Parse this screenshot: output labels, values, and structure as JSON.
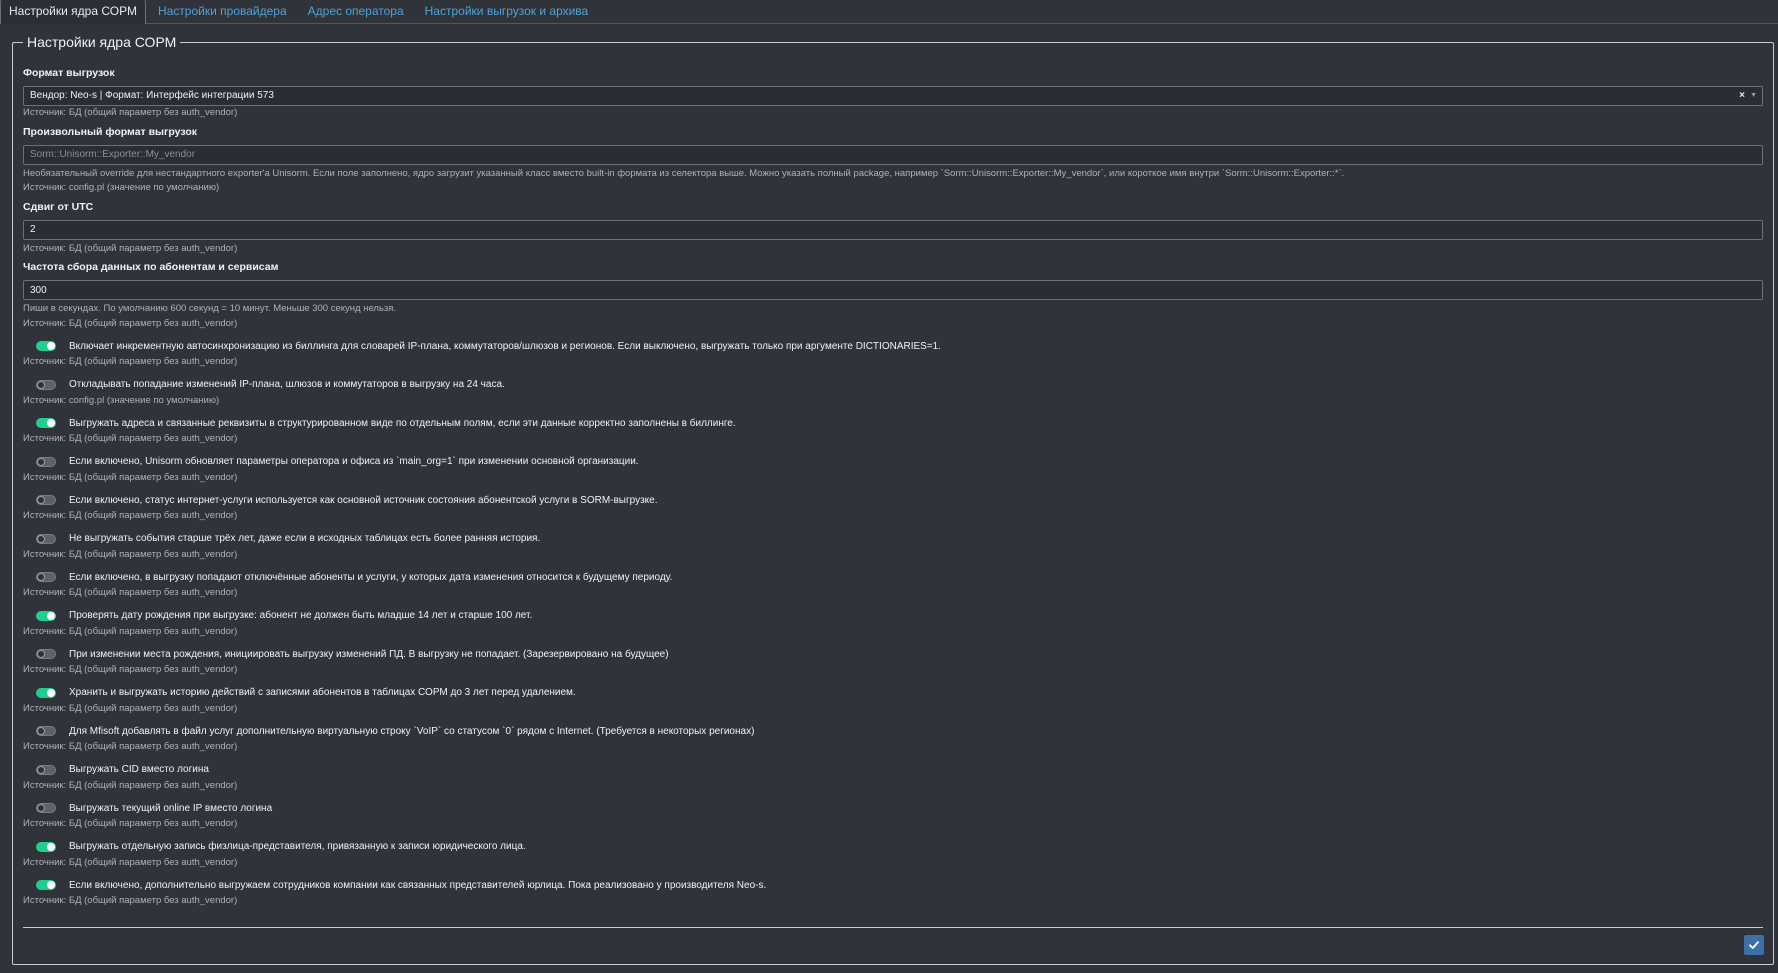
{
  "tabs": [
    {
      "label": "Настройки ядра СОРМ",
      "active": true
    },
    {
      "label": "Настройки провайдера",
      "active": false
    },
    {
      "label": "Адрес оператора",
      "active": false
    },
    {
      "label": "Настройки выгрузок и архива",
      "active": false
    }
  ],
  "panel": {
    "legend": "Настройки ядра СОРМ"
  },
  "fields": {
    "export_format": {
      "label": "Формат выгрузок",
      "value": "Вендор: Neo-s | Формат: Интерфейс интеграции 573",
      "clear_glyph": "×",
      "caret_glyph": "▼",
      "source": "Источник: БД (общий параметр без auth_vendor)"
    },
    "custom_format": {
      "label": "Произвольный формат выгрузок",
      "placeholder": "Sorm::Unisorm::Exporter::My_vendor",
      "description": "Необязательный override для нестандартного exporter'a Unisorm. Если поле заполнено, ядро загрузит указанный класс вместо built-in формата из селектора выше. Можно указать полный package, например `Sorm::Unisorm::Exporter::My_vendor`, или короткое имя внутри `Sorm::Unisorm::Exporter::*`.",
      "source": "Источник: config.pl (значение по умолчанию)"
    },
    "utc_offset": {
      "label": "Сдвиг от UTC",
      "value": "2",
      "source": "Источник: БД (общий параметр без auth_vendor)"
    },
    "collect_frequency": {
      "label": "Частота сбора данных по абонентам и сервисам",
      "value": "300",
      "description": "Пиши в секундах. По умолчанию 600 секунд = 10 минут. Меньше 300 секунд нельзя.",
      "source": "Источник: БД (общий параметр без auth_vendor)"
    }
  },
  "toggles": [
    {
      "on": true,
      "text": "Включает инкрементную автосинхронизацию из биллинга для словарей IP-плана, коммутаторов/шлюзов и регионов. Если выключено, выгружать только при аргументе DICTIONARIES=1.",
      "source": "Источник: БД (общий параметр без auth_vendor)"
    },
    {
      "on": false,
      "text": "Откладывать попадание изменений IP-плана, шлюзов и коммутаторов в выгрузку на 24 часа.",
      "source": "Источник: config.pl (значение по умолчанию)"
    },
    {
      "on": true,
      "text": "Выгружать адреса и связанные реквизиты в структурированном виде по отдельным полям, если эти данные корректно заполнены в биллинге.",
      "source": "Источник: БД (общий параметр без auth_vendor)"
    },
    {
      "on": false,
      "text": "Если включено, Unisorm обновляет параметры оператора и офиса из `main_org=1` при изменении основной организации.",
      "source": "Источник: БД (общий параметр без auth_vendor)"
    },
    {
      "on": false,
      "text": "Если включено, статус интернет-услуги используется как основной источник состояния абонентской услуги в SORM-выгрузке.",
      "source": "Источник: БД (общий параметр без auth_vendor)"
    },
    {
      "on": false,
      "text": "Не выгружать события старше трёх лет, даже если в исходных таблицах есть более ранняя история.",
      "source": "Источник: БД (общий параметр без auth_vendor)"
    },
    {
      "on": false,
      "text": "Если включено, в выгрузку попадают отключённые абоненты и услуги, у которых дата изменения относится к будущему периоду.",
      "source": "Источник: БД (общий параметр без auth_vendor)"
    },
    {
      "on": true,
      "text": "Проверять дату рождения при выгрузке: абонент не должен быть младше 14 лет и старше 100 лет.",
      "source": "Источник: БД (общий параметр без auth_vendor)"
    },
    {
      "on": false,
      "text": "При изменении места рождения, инициировать выгрузку изменений ПД. В выгрузку не попадает. (Зарезервировано на будущее)",
      "source": "Источник: БД (общий параметр без auth_vendor)"
    },
    {
      "on": true,
      "text": "Хранить и выгружать историю действий с записями абонентов в таблицах СОРМ до 3 лет перед удалением.",
      "source": "Источник: БД (общий параметр без auth_vendor)"
    },
    {
      "on": false,
      "text": "Для Mfisoft добавлять в файл услуг дополнительную виртуальную строку `VoIP` со статусом `0` рядом с Internet. (Требуется в некоторых регионах)",
      "source": "Источник: БД (общий параметр без auth_vendor)"
    },
    {
      "on": false,
      "text": "Выгружать CID вместо логина",
      "source": "Источник: БД (общий параметр без auth_vendor)"
    },
    {
      "on": false,
      "text": "Выгружать текущий online IP вместо логина",
      "source": "Источник: БД (общий параметр без auth_vendor)"
    },
    {
      "on": true,
      "text": "Выгружать отдельную запись физлица-представителя, привязанную к записи юридического лица.",
      "source": "Источник: БД (общий параметр без auth_vendor)"
    },
    {
      "on": true,
      "text": "Если включено, дополнительно выгружаем сотрудников компании как связанных представителей юрлица. Пока реализовано у производителя Neo-s.",
      "source": "Источник: БД (общий параметр без auth_vendor)"
    }
  ],
  "actions": {
    "save_icon": "check-icon"
  },
  "colors": {
    "background": "#30333a",
    "accent_link": "#4da3d9",
    "toggle_on": "#1fcf8d",
    "toggle_off": "#5d6168",
    "save_button": "#3d6fa8"
  }
}
